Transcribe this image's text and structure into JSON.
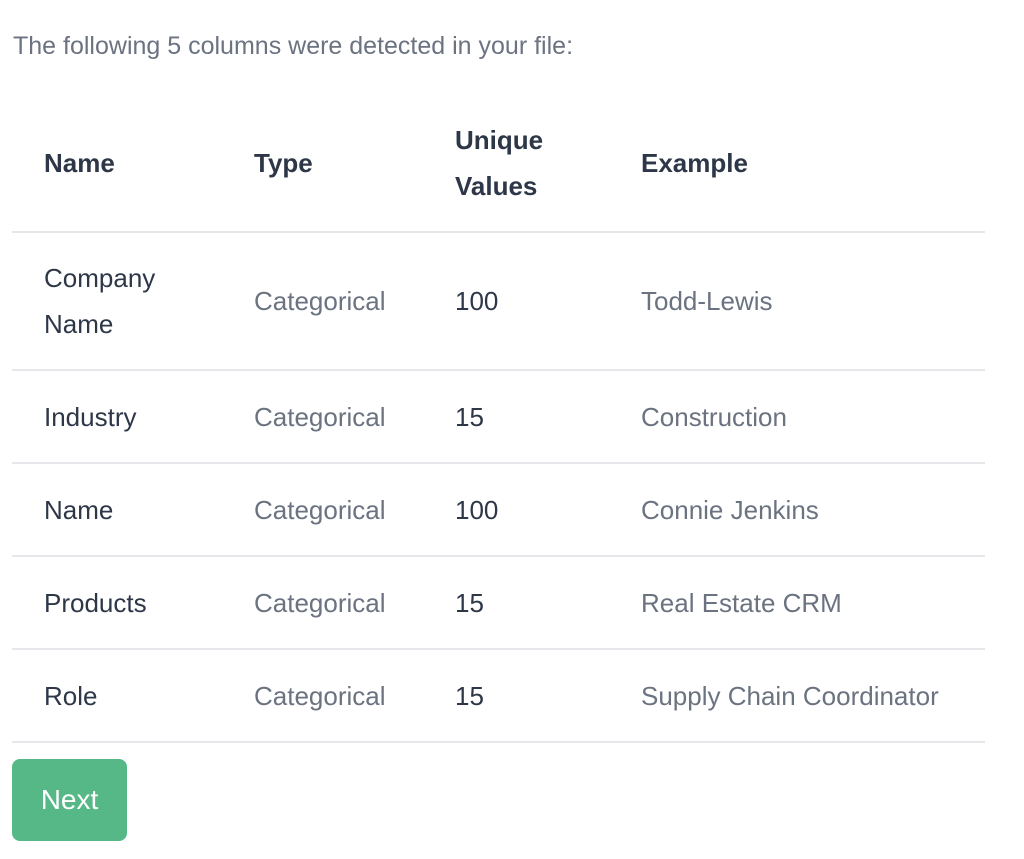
{
  "intro_text": "The following 5 columns were detected in your file:",
  "table": {
    "headers": {
      "name": "Name",
      "type": "Type",
      "unique_values": "Unique Values",
      "example": "Example"
    },
    "rows": [
      {
        "name": "Company Name",
        "type": "Categorical",
        "unique_values": "100",
        "example": "Todd-Lewis"
      },
      {
        "name": "Industry",
        "type": "Categorical",
        "unique_values": "15",
        "example": "Construction"
      },
      {
        "name": "Name",
        "type": "Categorical",
        "unique_values": "100",
        "example": "Connie Jenkins"
      },
      {
        "name": "Products",
        "type": "Categorical",
        "unique_values": "15",
        "example": "Real Estate CRM"
      },
      {
        "name": "Role",
        "type": "Categorical",
        "unique_values": "15",
        "example": "Supply Chain Coordinator"
      }
    ]
  },
  "next_button": {
    "label": "Next",
    "color": "#55b886"
  }
}
